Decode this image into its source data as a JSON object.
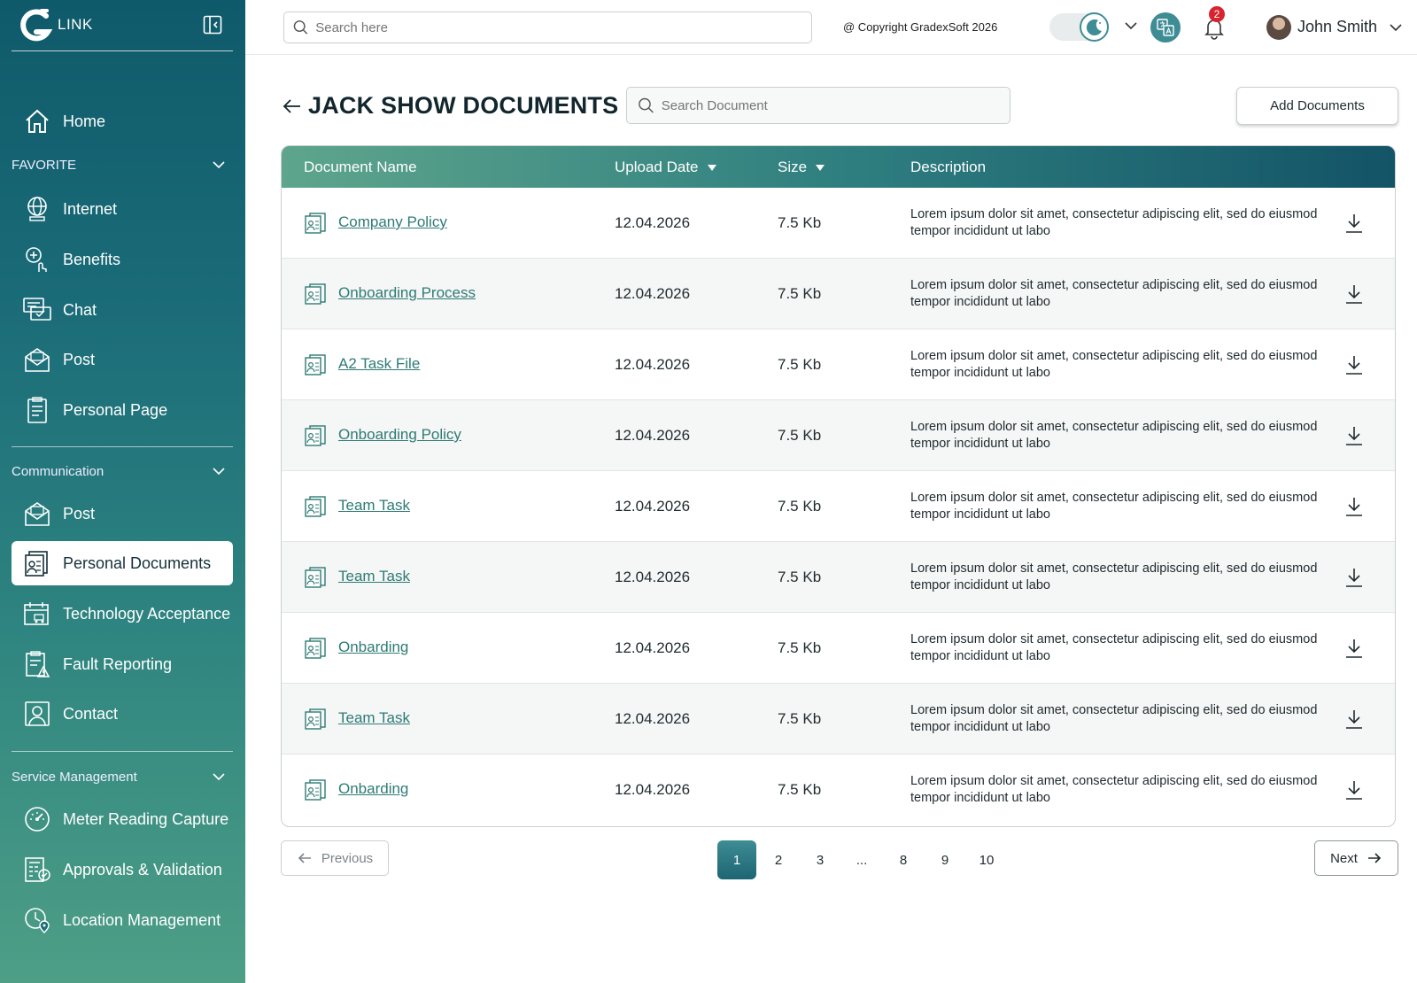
{
  "brand": {
    "name": "LINK"
  },
  "sidebar": {
    "home": "Home",
    "sections": {
      "favorite": "FAVORITE",
      "communication": "Communication",
      "service": "Service Management"
    },
    "favorite_items": [
      "Internet",
      "Benefits",
      "Chat",
      "Post",
      "Personal Page"
    ],
    "communication_items": [
      "Post",
      "Personal Documents",
      "Technology Acceptance",
      "Fault Reporting",
      "Contact"
    ],
    "service_items": [
      "Meter Reading Capture",
      "Approvals & Validation",
      "Location Management"
    ],
    "active_item": "Personal Documents"
  },
  "topbar": {
    "search_placeholder": "Search here",
    "copyright": "@ Copyright GradexSoft 2026",
    "notification_count": "2",
    "user_name": "John Smith"
  },
  "page": {
    "title": "JACK SHOW DOCUMENTS",
    "search_placeholder": "Search Document",
    "add_button": "Add Documents"
  },
  "table": {
    "columns": [
      "Document Name",
      "Upload Date",
      "Size",
      "Description"
    ],
    "rows": [
      {
        "name": "Company Policy",
        "date": "12.04.2026",
        "size": "7.5 Kb",
        "desc": "Lorem ipsum dolor sit amet, consectetur adipiscing elit, sed do eiusmod tempor incididunt ut labo"
      },
      {
        "name": "Onboarding Process",
        "date": "12.04.2026",
        "size": "7.5 Kb",
        "desc": "Lorem ipsum dolor sit amet, consectetur adipiscing elit, sed do eiusmod tempor incididunt ut labo"
      },
      {
        "name": "A2 Task File",
        "date": "12.04.2026",
        "size": "7.5 Kb",
        "desc": "Lorem ipsum dolor sit amet, consectetur adipiscing elit, sed do eiusmod tempor incididunt ut labo"
      },
      {
        "name": "Onboarding Policy",
        "date": "12.04.2026",
        "size": "7.5 Kb",
        "desc": "Lorem ipsum dolor sit amet, consectetur adipiscing elit, sed do eiusmod tempor incididunt ut labo"
      },
      {
        "name": "Team Task",
        "date": "12.04.2026",
        "size": "7.5 Kb",
        "desc": "Lorem ipsum dolor sit amet, consectetur adipiscing elit, sed do eiusmod tempor incididunt ut labo"
      },
      {
        "name": "Team Task",
        "date": "12.04.2026",
        "size": "7.5 Kb",
        "desc": "Lorem ipsum dolor sit amet, consectetur adipiscing elit, sed do eiusmod tempor incididunt ut labo"
      },
      {
        "name": "Onbarding",
        "date": "12.04.2026",
        "size": "7.5 Kb",
        "desc": "Lorem ipsum dolor sit amet, consectetur adipiscing elit, sed do eiusmod tempor incididunt ut labo"
      },
      {
        "name": "Team Task",
        "date": "12.04.2026",
        "size": "7.5 Kb",
        "desc": "Lorem ipsum dolor sit amet, consectetur adipiscing elit, sed do eiusmod tempor incididunt ut labo"
      },
      {
        "name": "Onbarding",
        "date": "12.04.2026",
        "size": "7.5 Kb",
        "desc": "Lorem ipsum dolor sit amet, consectetur adipiscing elit, sed do eiusmod tempor incididunt ut labo"
      }
    ]
  },
  "pagination": {
    "previous": "Previous",
    "next": "Next",
    "pages": [
      "1",
      "2",
      "3",
      "...",
      "8",
      "9",
      "10"
    ],
    "current": "1"
  },
  "colors": {
    "sidebar_top": "#0f5a6a",
    "sidebar_bottom": "#4e9f86",
    "accent": "#3e8c94",
    "link": "#2e7b75",
    "badge": "#d8242e"
  }
}
